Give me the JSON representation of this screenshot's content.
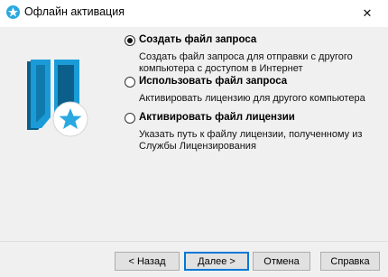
{
  "window": {
    "title": "Офлайн активация",
    "close_glyph": "✕",
    "icon": "star-gear-icon"
  },
  "options": [
    {
      "label": "Создать файл запроса",
      "selected": true,
      "description": "Создать файл запроса для отправки с другого компьютера с доступом в Интернет"
    },
    {
      "label": "Использовать файл запроса",
      "selected": false,
      "description": "Активировать лицензию для другого компьютера"
    },
    {
      "label": "Активировать файл лицензии",
      "selected": false,
      "description": "Указать путь к файлу лицензии, полученному из Службы Лицензирования"
    }
  ],
  "buttons": {
    "back": "< Назад",
    "next": "Далее >",
    "cancel": "Отмена",
    "help": "Справка"
  },
  "colors": {
    "accent": "#0078d7",
    "logo_blue": "#1a9bd7",
    "logo_dark": "#0b5f8a",
    "star_blue": "#29a9e0"
  }
}
